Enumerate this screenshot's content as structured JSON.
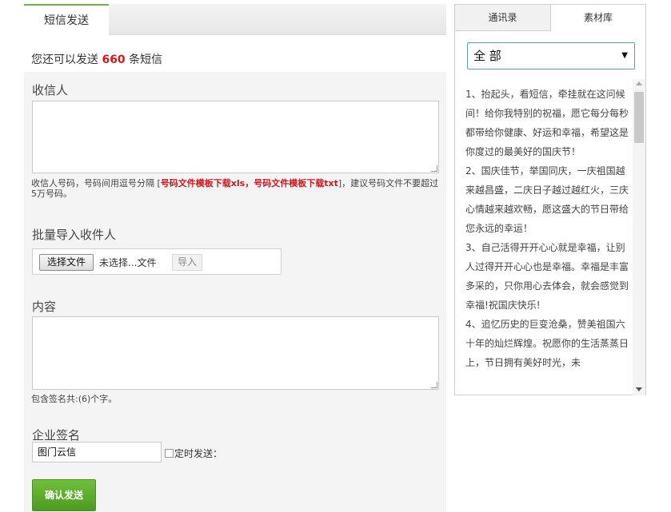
{
  "tabs": {
    "sms_send": "短信发送"
  },
  "quota": {
    "prefix": "您还可以发送",
    "count": "660",
    "suffix": "条短信"
  },
  "recipients": {
    "label": "收信人",
    "value": "",
    "hint_prefix": "收信人号码，号码间用逗号分隔 [",
    "template_xls": "号码文件模板下载xls",
    "hint_sep": "，",
    "template_txt": "号码文件模板下载txt",
    "hint_suffix": "]，建议号码文件不要超过5万号码。"
  },
  "batch_import": {
    "label": "批量导入收件人",
    "choose_file": "选择文件",
    "file_status": "未选择...文件",
    "import_button": "导入"
  },
  "content": {
    "label": "内容",
    "value": "",
    "count_prefix": "包含签名共:(",
    "count": "6",
    "count_suffix": ")个字。"
  },
  "signature": {
    "label": "企业签名",
    "value": "图门云信",
    "schedule_label": "定时发送："
  },
  "submit_label": "确认发送",
  "side_panel": {
    "tab_contacts": "通讯录",
    "tab_library": "素材库",
    "category_selected": "全 部",
    "messages": [
      "1、抬起头，看短信，牵挂就在这问候间！给你我特别的祝福，愿它每分每秒都带给你健康、好运和幸福，希望这是你度过的最美好的国庆节！",
      "2、国庆佳节，举国同庆，一庆祖国越来越昌盛，二庆日子越过越红火，三庆心情越来越欢畅，愿这盛大的节日带给您永远的幸运！",
      "3、自己活得开开心心就是幸福，让别人过得开开心心也是幸福。幸福是丰富多采的，只你用心去体会，就会感觉到幸福!祝国庆快乐!",
      "4、追忆历史的巨变沧桑，赞美祖国六十年的灿烂辉煌。祝愿你的生活蒸蒸日上，节日拥有美好时光，未"
    ]
  },
  "colors": {
    "accent_green": "#6cb33f",
    "highlight_red": "#d2161e",
    "select_border": "#5b9bd5"
  }
}
